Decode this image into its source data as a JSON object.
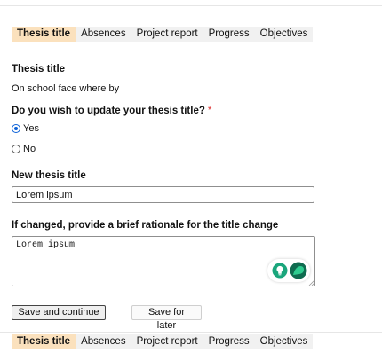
{
  "tabs": {
    "items": [
      "Thesis title",
      "Absences",
      "Project report",
      "Progress",
      "Objectives"
    ],
    "active": "Thesis title"
  },
  "current_title": {
    "label": "Thesis title",
    "value": "On school face where by"
  },
  "update_question": {
    "label": "Do you wish to update your thesis title?",
    "required_mark": "*",
    "options": [
      "Yes",
      "No"
    ],
    "selected": "Yes"
  },
  "new_title": {
    "label": "New thesis title",
    "value": "Lorem ipsum"
  },
  "rationale": {
    "label": "If changed, provide a brief rationale for the title change",
    "value": "Lorem ipsum"
  },
  "buttons": {
    "save_continue": "Save and continue",
    "save_later": "Save for later"
  },
  "colors": {
    "active_tab": "#fbe1bd",
    "tab_bar": "#f1f1f1",
    "required": "#dd3333",
    "radio_selected": "#0b61d8",
    "assistant_green": "#1aa67c"
  },
  "icons": {
    "assistant_left": "lightbulb-icon",
    "assistant_right": "grammar-assistant-icon"
  }
}
